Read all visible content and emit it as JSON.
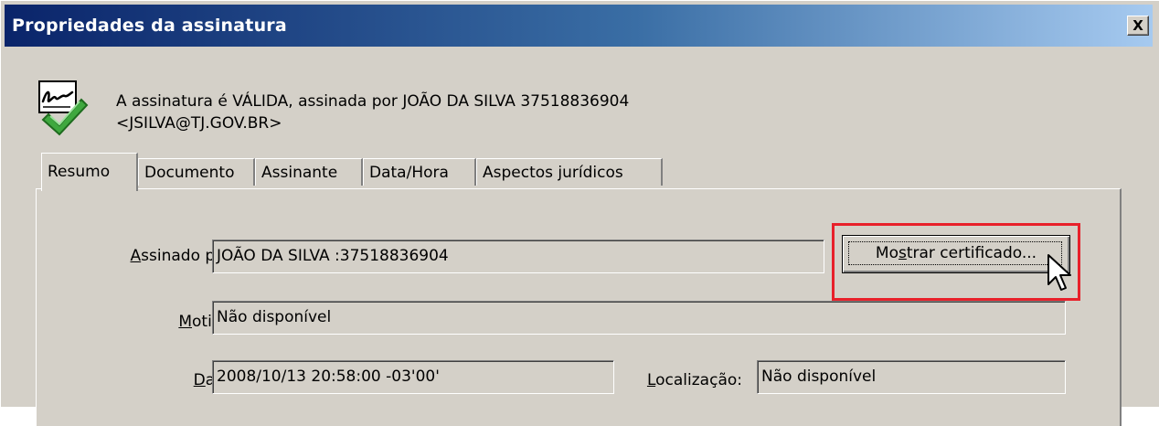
{
  "window": {
    "title": "Propriedades da assinatura",
    "close_label": "X"
  },
  "status": {
    "line1": "A assinatura é VÁLIDA, assinada por JOÃO DA SILVA 37518836904",
    "line2": "<JSILVA@TJ.GOV.BR>",
    "icon": "signature-valid-icon"
  },
  "tabs": [
    {
      "label": "Resumo",
      "active": true
    },
    {
      "label": "Documento",
      "active": false
    },
    {
      "label": "Assinante",
      "active": false
    },
    {
      "label": "Data/Hora",
      "active": false
    },
    {
      "label": "Aspectos jurídicos",
      "active": false
    }
  ],
  "summary": {
    "signed_by_label_accel": "A",
    "signed_by_label_rest": "ssinado por:",
    "signed_by_value": "JOÃO DA SILVA :37518836904",
    "reason_label_accel": "M",
    "reason_label_rest": "otivo:",
    "reason_value": "Não disponível",
    "date_label_accel": "D",
    "date_label_rest": "ata:",
    "date_value": "2008/10/13 20:58:00 -03'00'",
    "location_label_accel": "L",
    "location_label_rest": "ocalização:",
    "location_value": "Não disponível",
    "show_cert_pre": "Mo",
    "show_cert_accel": "s",
    "show_cert_post": "trar certificado..."
  },
  "colors": {
    "titlebar_start": "#0a246a",
    "titlebar_end": "#a6caf0",
    "dialog_bg": "#d4d0c8",
    "highlight": "#e8202a"
  }
}
